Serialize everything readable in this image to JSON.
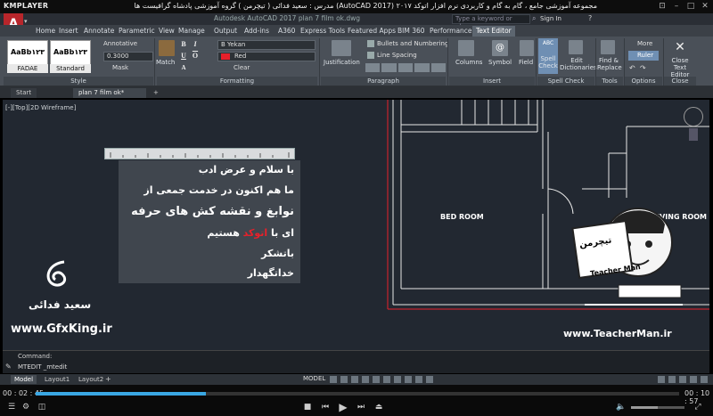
{
  "player": {
    "logo": "KMPLAYER",
    "title": "مجموعه آموزشی جامع ، گام به گام و کاربردی نرم افزار اتوکد ۲۰۱۷ (AutoCAD 2017) مدرس : سعید فدائی ( تیچرمن ) گروه آموزشی پادشاه گرافیست ها",
    "time_elapsed": "00 : 02 : 45",
    "time_total": "00 : 10 : 57",
    "progress": 0.265,
    "volume": 0.5,
    "controls": [
      "stop-icon",
      "previous-icon",
      "play-icon",
      "next-icon",
      "eject-icon"
    ]
  },
  "autocad": {
    "title": "Autodesk AutoCAD 2017    plan 7 film ok.dwg",
    "search_placeholder": "Type a keyword or phrase",
    "sign_in": "Sign In",
    "ribbon_tabs": [
      "Home",
      "Insert",
      "Annotate",
      "Parametric",
      "View",
      "Manage",
      "Output",
      "Add-ins",
      "A360",
      "Express Tools",
      "Featured Apps",
      "BIM 360",
      "Performance",
      "Text Editor"
    ],
    "active_tab": "Text Editor",
    "ribbon": {
      "style_sample_1": "AaBb۱۲۳",
      "style_sample_2": "AaBb۱۲۳",
      "style_name_1": "FADAE",
      "style_name_2": "Standard",
      "annotative": "Annotative",
      "text_height": "0.3000",
      "mask": "Mask",
      "match": "Match",
      "font": "B Yekan",
      "color": "Red",
      "clear": "Clear",
      "justification": "Justification",
      "bullets": "Bullets and Numbering",
      "line_spacing": "Line Spacing",
      "columns": "Columns",
      "symbol": "Symbol",
      "field": "Field",
      "spell_check": "Spell Check",
      "edit_dict": "Edit Dictionaries",
      "find_replace": "Find & Replace",
      "more": "More",
      "ruler": "Ruler",
      "close_editor": "Close Text Editor",
      "panels": [
        "Style",
        "Formatting",
        "Paragraph",
        "Insert",
        "Spell Check",
        "Tools",
        "Options",
        "Close"
      ]
    },
    "doc_tabs": {
      "start": "Start",
      "current": "plan 7 film ok*"
    },
    "viewport_label": "[-][Top][2D Wireframe]",
    "rooms": {
      "bed": "BED ROOM",
      "living": "LIVING ROOM"
    },
    "mtext": {
      "lines": [
        "با سلام و عرض ادب",
        "ما هم اکنون در خدمت جمعی از",
        "نوابغ و نقشه کش های حرفه",
        "ای با اتوکد هستیم",
        "باتشکر",
        "خداتگهدار"
      ],
      "highlight": "اتوکد"
    },
    "command": {
      "history": "Command:",
      "input": "MTEDIT _mtedit"
    },
    "layout_tabs": [
      "Model",
      "Layout1",
      "Layout2"
    ],
    "status_model": "MODEL"
  },
  "watermarks": {
    "author_fa": "سعید فدائی",
    "site_left": "www.GfxKing.ir",
    "brand_fa": "تیچرمن",
    "brand_en": "Teacher Man",
    "site_right": "www.TeacherMan.ir"
  },
  "colors": {
    "accent_red": "#e8202a",
    "drawing_bg": "#222831",
    "seek": "#3aa7e3"
  }
}
